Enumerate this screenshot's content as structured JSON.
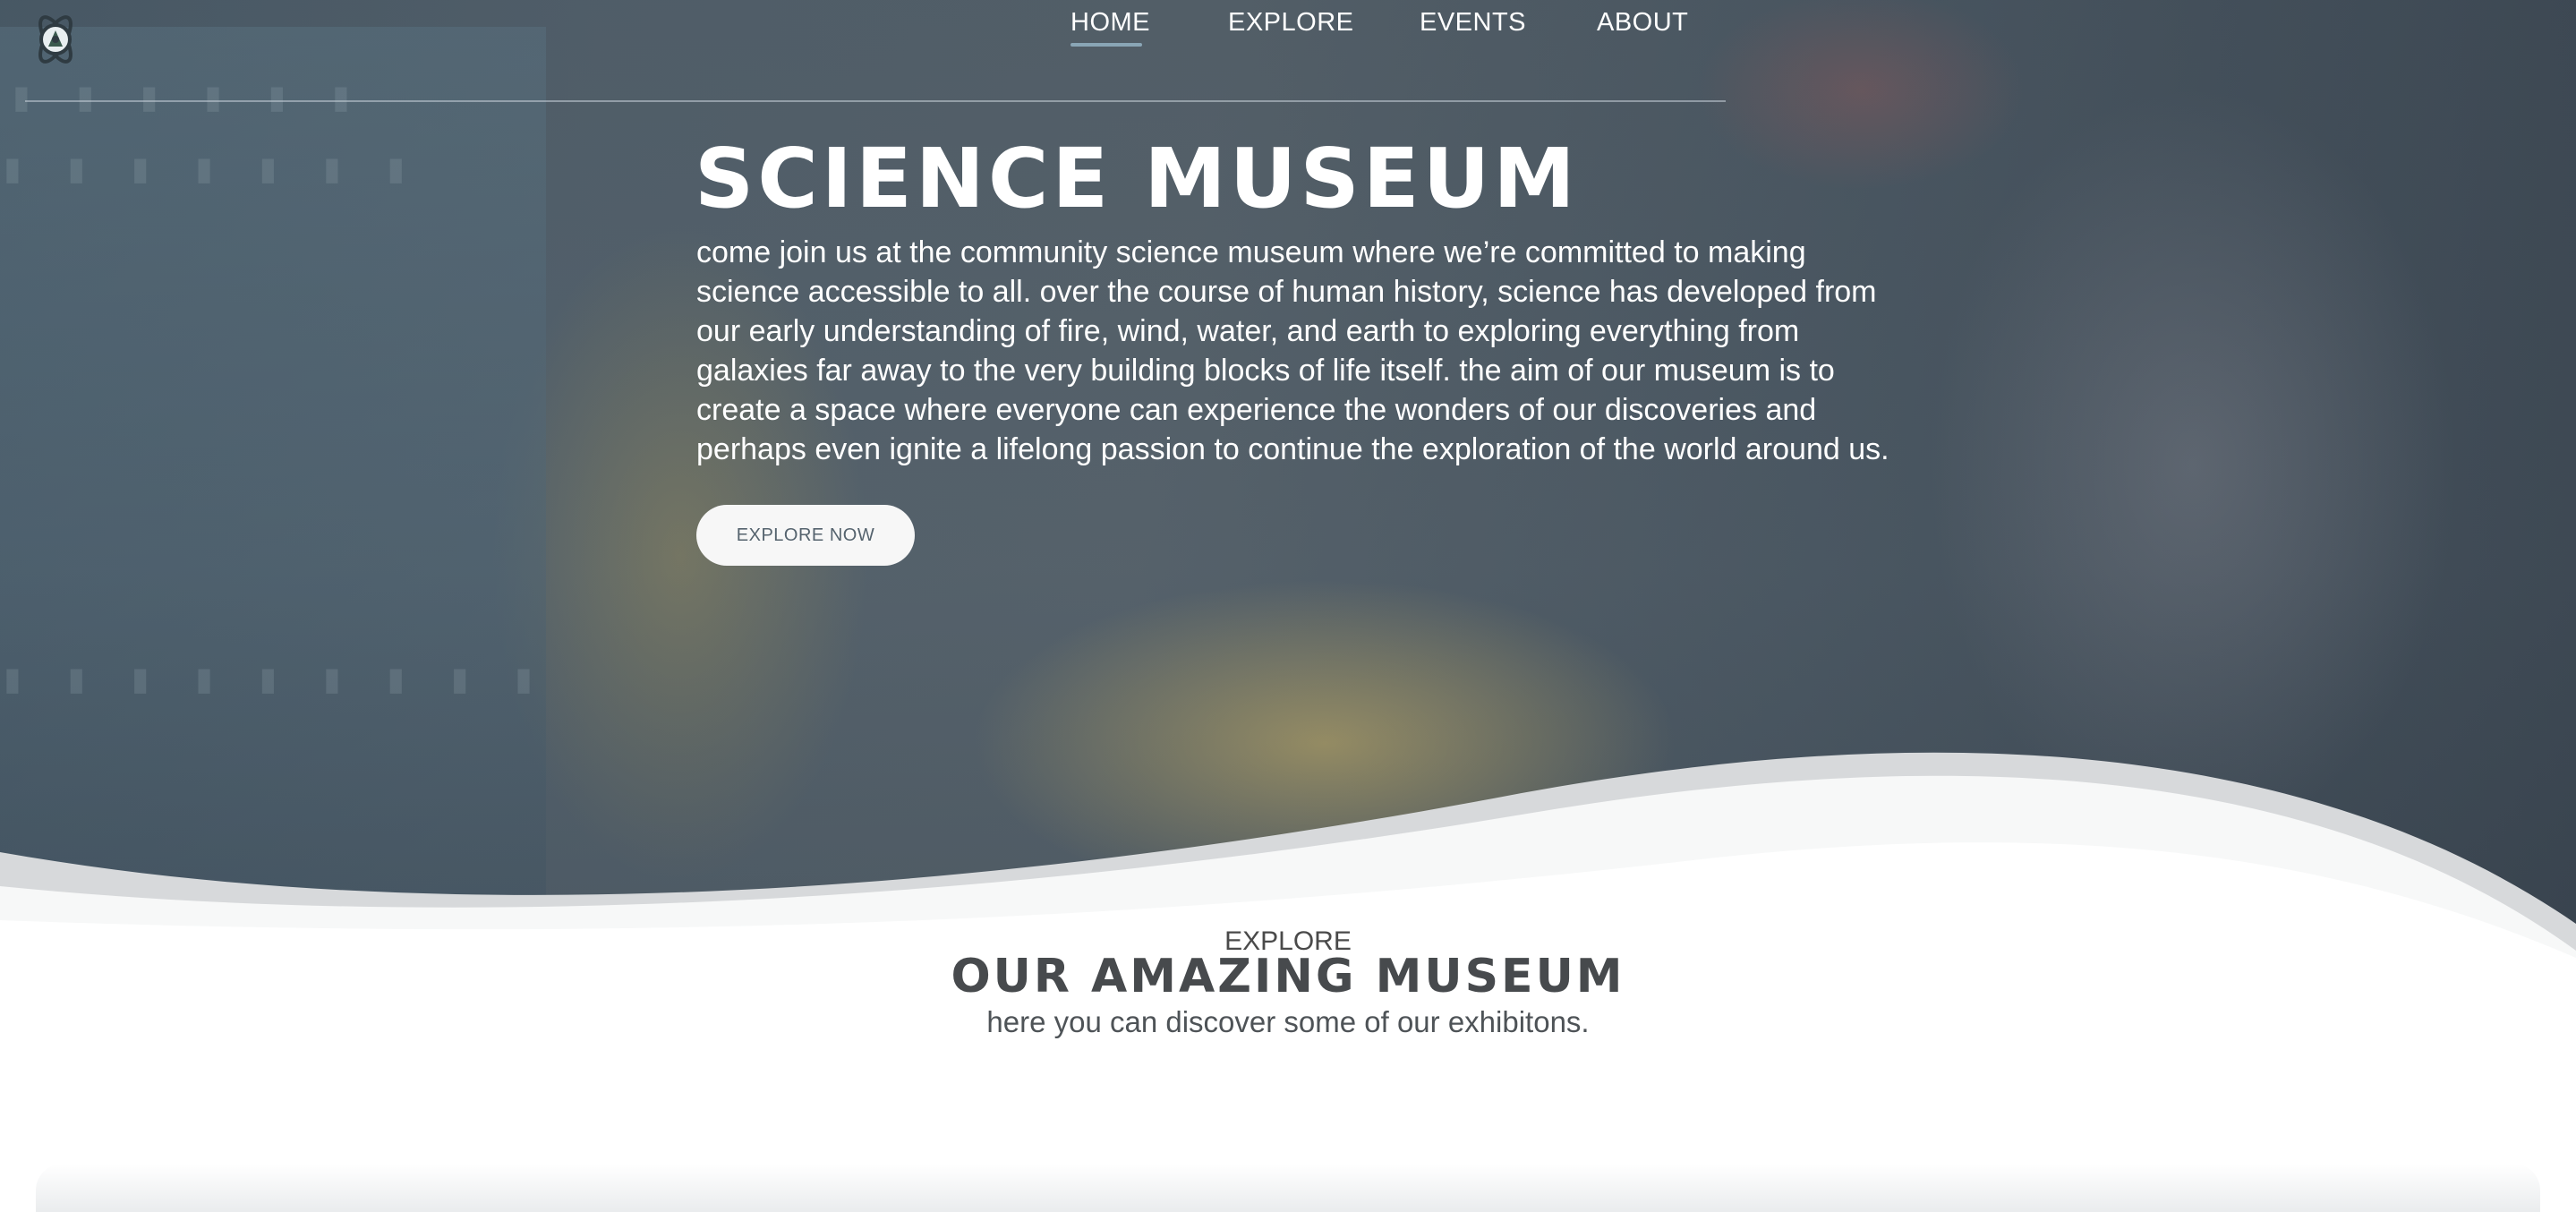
{
  "nav": {
    "items": [
      {
        "label": "HOME",
        "active": true
      },
      {
        "label": "EXPLORE",
        "active": false
      },
      {
        "label": "EVENTS",
        "active": false
      },
      {
        "label": "ABOUT",
        "active": false
      }
    ],
    "logo_icon": "atom-planet-logo-icon"
  },
  "hero": {
    "title": "SCIENCE MUSEUM",
    "description": "come join us at the community science museum where we’re committed to making science accessible to all. over the course of human history, science has developed from our early understanding of fire, wind, water, and earth to exploring everything from galaxies far away to the very building blocks of life itself. the aim of our museum is to create a space where everyone can experience the wonders of our discoveries and perhaps even ignite a lifelong passion to continue the exploration of the world around us.",
    "button_label": "EXPLORE NOW"
  },
  "explore": {
    "kicker": "EXPLORE",
    "title": "OUR AMAZING MUSEUM",
    "subtitle": "here you can discover some of our exhibitons."
  },
  "colors": {
    "hero_overlay": "#56646f",
    "nav_underline": "#8aa6b6",
    "button_bg": "#f7f7f7",
    "button_text": "#55636e",
    "section_title": "#474a4d"
  }
}
